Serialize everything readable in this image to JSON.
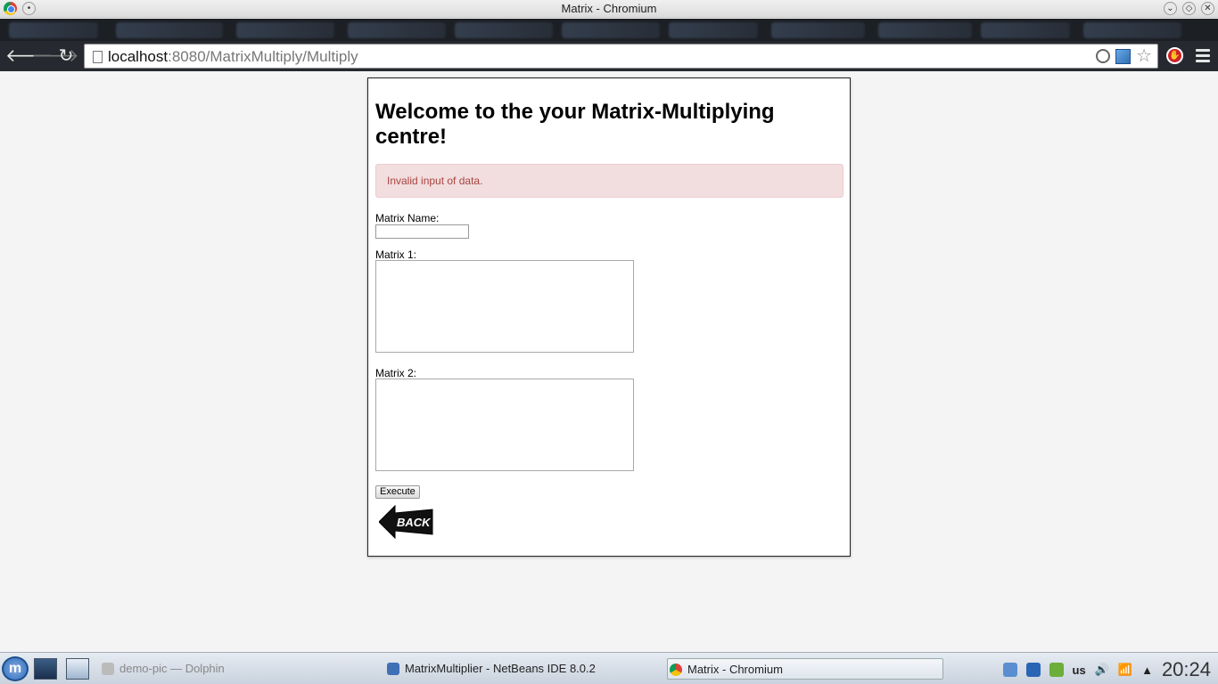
{
  "window": {
    "title": "Matrix - Chromium"
  },
  "browser": {
    "url_host": "localhost",
    "url_path": ":8080/MatrixMultiply/Multiply"
  },
  "page": {
    "heading": "Welcome to the your Matrix-Multiplying centre!",
    "alert": "Invalid input of data.",
    "matrix_name_label": "Matrix Name:",
    "matrix_name_value": "",
    "matrix1_label": "Matrix 1:",
    "matrix1_value": "",
    "matrix2_label": "Matrix 2:",
    "matrix2_value": "",
    "execute_label": "Execute",
    "back_image_text": "BACK"
  },
  "taskbar": {
    "tasks": [
      {
        "label": "demo-pic — Dolphin",
        "state": "inactive"
      },
      {
        "label": "MatrixMultiplier - NetBeans IDE 8.0.2",
        "state": "normal"
      },
      {
        "label": "Matrix - Chromium",
        "state": "active"
      }
    ],
    "keyboard_layout": "us",
    "clock": "20:24"
  },
  "colors": {
    "alert_bg": "#f2dede",
    "alert_text": "#a94442",
    "toolbar_bg": "#262a30"
  }
}
